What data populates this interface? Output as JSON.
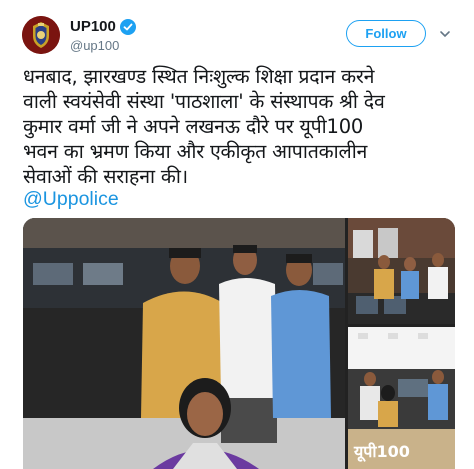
{
  "profile": {
    "display_name": "UP100",
    "handle": "@up100",
    "verified": true,
    "avatar_icon": "police-emblem-icon"
  },
  "actions": {
    "follow_label": "Follow",
    "more_icon": "chevron-down-icon"
  },
  "tweet": {
    "text_lines": [
      "धनबाद, झारखण्ड स्थित निःशुल्क शिक्षा प्रदान करने",
      "वाली स्वयंसेवी संस्था 'पाठशाला' के संस्थापक श्री देव",
      "कुमार वर्मा जी ने अपने लखनऊ दौरे पर यूपी100",
      "भवन का भ्रमण किया और एकीकृत आपातकालीन",
      "सेवाओं की सराहना की।"
    ],
    "mention": "@Uppolice"
  },
  "media": {
    "images": [
      {
        "name": "main-photo"
      },
      {
        "name": "top-right-photo"
      },
      {
        "name": "bottom-right-photo"
      }
    ],
    "bottom_sign_text": "यूपी100"
  },
  "colors": {
    "accent": "#1da1f2",
    "link": "#1b95e0",
    "text": "#14171a",
    "secondary": "#657786"
  }
}
